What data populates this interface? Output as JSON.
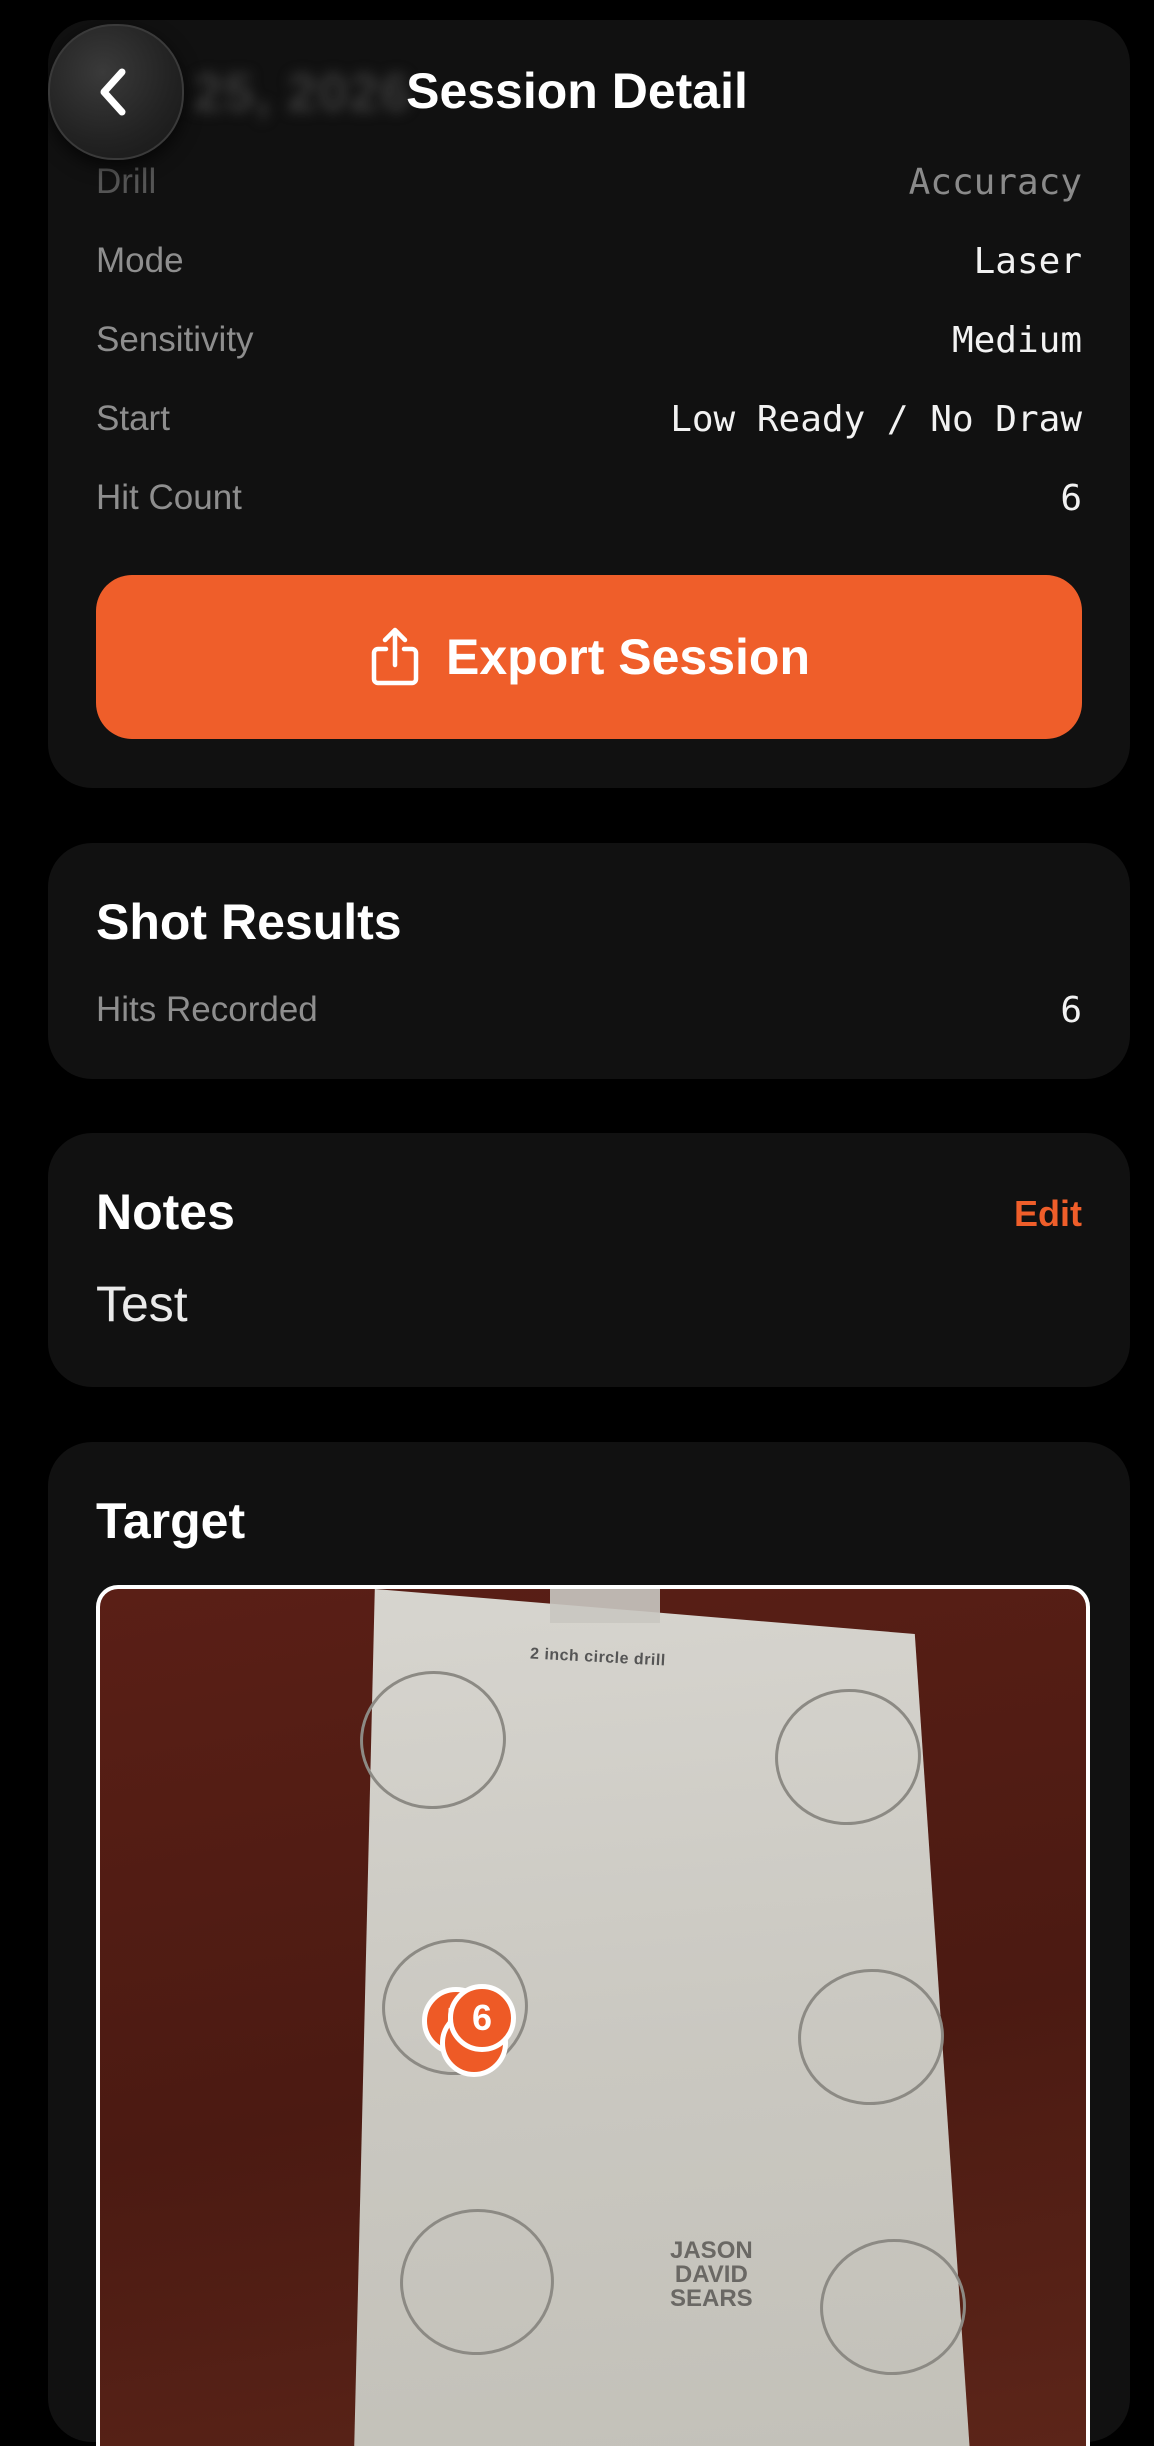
{
  "header": {
    "title": "Session Detail",
    "blurred_date": "Jul 25, 2026",
    "back_icon": "chevron-left-icon"
  },
  "details": {
    "rows": [
      {
        "label": "Drill",
        "value": "Accuracy"
      },
      {
        "label": "Mode",
        "value": "Laser"
      },
      {
        "label": "Sensitivity",
        "value": "Medium"
      },
      {
        "label": "Start",
        "value": "Low Ready / No Draw"
      },
      {
        "label": "Hit Count",
        "value": "6"
      }
    ],
    "export_label": "Export Session",
    "export_icon": "share-icon"
  },
  "shot_results": {
    "title": "Shot Results",
    "hits_label": "Hits Recorded",
    "hits_value": "6"
  },
  "notes": {
    "title": "Notes",
    "edit_label": "Edit",
    "text": "Test"
  },
  "target": {
    "title": "Target",
    "drill_text": "2 inch circle drill",
    "logo_lines": [
      "JASON",
      "DAVID",
      "SEARS"
    ],
    "markers": [
      "5",
      "6"
    ]
  },
  "colors": {
    "accent": "#EF5E2A",
    "background": "#000000",
    "card": "#111111"
  }
}
